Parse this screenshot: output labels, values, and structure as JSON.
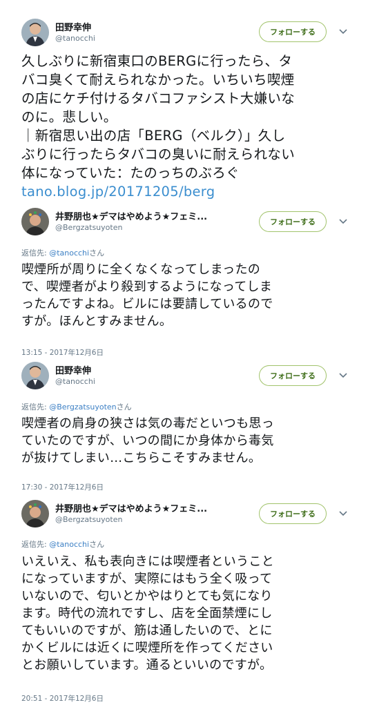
{
  "tweets": [
    {
      "name": "田野幸伸",
      "handle": "@tanocchi",
      "follow_label": "フォローする",
      "lines": [
        "久しぶりに新宿東口のBERGに行ったら、タ",
        "バコ臭くて耐えられなかった。いちいち喫煙",
        "の店にケチ付けるタバコファシスト大嫌いな",
        "のに。悲しい。",
        "｜新宿思い出の店「BERG（ベルク）」久し",
        "ぶりに行ったらタバコの臭いに耐えられない",
        "体になっていた：たのっちのぶろぐ"
      ],
      "link": "tano.blog.jp/20171205/berg"
    },
    {
      "name": "井野朋也★デマはやめよう★フェミ...",
      "handle": "@Bergzatsuyoten",
      "follow_label": "フォローする",
      "reply_prefix": "返信先: ",
      "reply_mention": "@tanocchi",
      "reply_suffix": "さん",
      "lines": [
        "喫煙所が周りに全くなくなってしまったの",
        "で、喫煙者がより殺到するようになってしま",
        "ったんですよね。ビルには要請しているので",
        "すが。ほんとすみません。"
      ],
      "timestamp": "13:15 - 2017年12月6日"
    },
    {
      "name": "田野幸伸",
      "handle": "@tanocchi",
      "follow_label": "フォローする",
      "reply_prefix": "返信先: ",
      "reply_mention": "@Bergzatsuyoten",
      "reply_suffix": "さん",
      "lines": [
        "喫煙者の肩身の狭さは気の毒だといつも思っ",
        "ていたのですが、いつの間にか身体から毒気",
        "が抜けてしまい…こちらこそすみません。"
      ],
      "timestamp": "17:30 - 2017年12月6日"
    },
    {
      "name": "井野朋也★デマはやめよう★フェミ...",
      "handle": "@Bergzatsuyoten",
      "follow_label": "フォローする",
      "reply_prefix": "返信先: ",
      "reply_mention": "@tanocchi",
      "reply_suffix": "さん",
      "lines": [
        "いえいえ、私も表向きには喫煙者ということ",
        "になっていますが、実際にはもう全く吸って",
        "いないので、匂いとかやはりとても気になり",
        "ます。時代の流れですし、店を全面禁煙にし",
        "てもいいのですが、筋は通したいので、とに",
        "かくビルには近くに喫煙所を作ってください",
        "とお願いしています。通るといいのですが。"
      ],
      "timestamp": "20:51 - 2017年12月6日"
    }
  ],
  "colors": {
    "follow_border": "#a1c36b",
    "follow_text": "#3f6e1a",
    "link": "#3b8ecf",
    "mention": "#3b7fc4",
    "meta": "#657786"
  }
}
